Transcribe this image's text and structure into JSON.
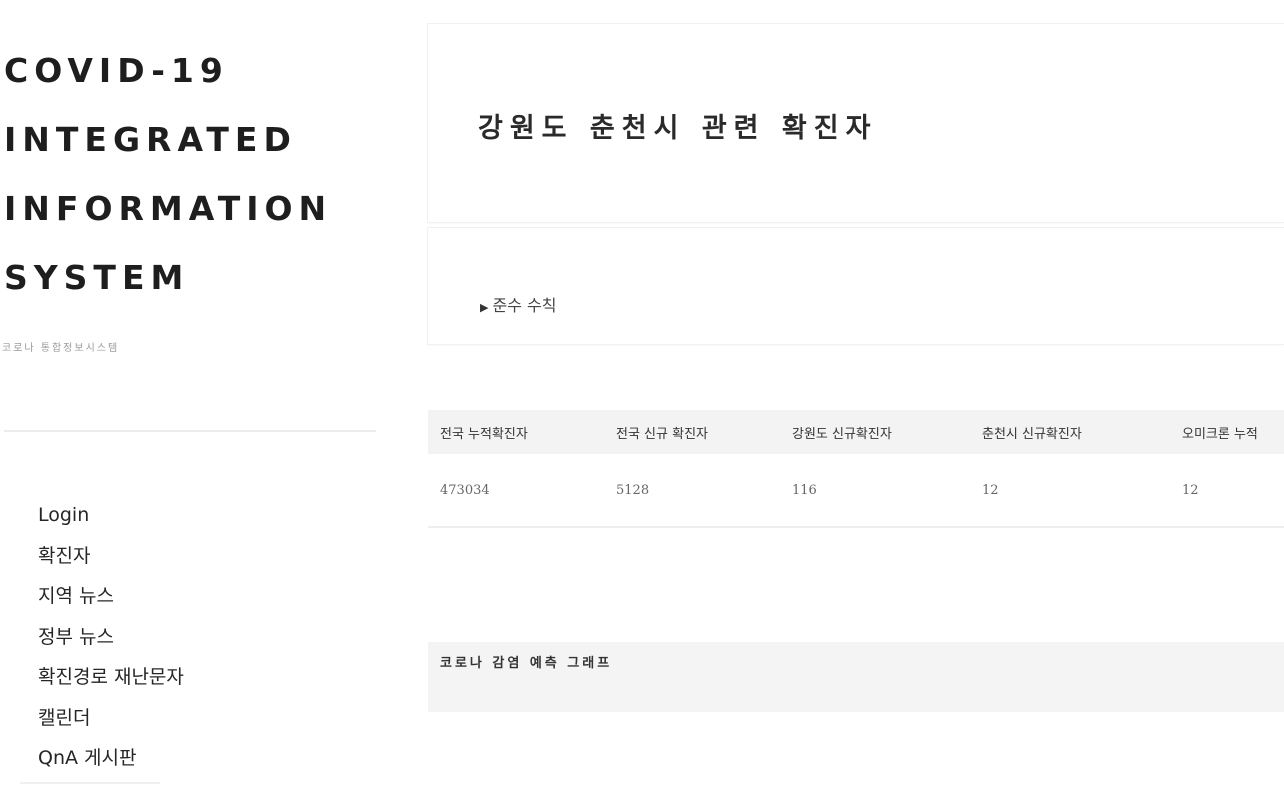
{
  "sidebar": {
    "brand_lines": [
      "COVID-19",
      "INTEGRATED",
      "INFORMATION",
      "SYSTEM"
    ],
    "subtitle": "코로나 통합정보시스템",
    "nav": [
      {
        "label": "Login"
      },
      {
        "label": "확진자"
      },
      {
        "label": "지역 뉴스"
      },
      {
        "label": "정부 뉴스"
      },
      {
        "label": "확진경로 재난문자"
      },
      {
        "label": "캘린더"
      },
      {
        "label": "QnA 게시판"
      }
    ]
  },
  "main": {
    "title": "강원도 춘천시 관련 확진자",
    "rules_link": {
      "arrow": "▶",
      "label": "준수 수칙"
    },
    "stats": {
      "headers": [
        "전국 누적확진자",
        "전국 신규 확진자",
        "강원도 신규확진자",
        "춘천시 신규확진자",
        "오미크론 누적"
      ],
      "values": [
        "473034",
        "5128",
        "116",
        "12",
        "12"
      ]
    },
    "graph": {
      "title": "코로나 감염 예측 그래프"
    }
  }
}
